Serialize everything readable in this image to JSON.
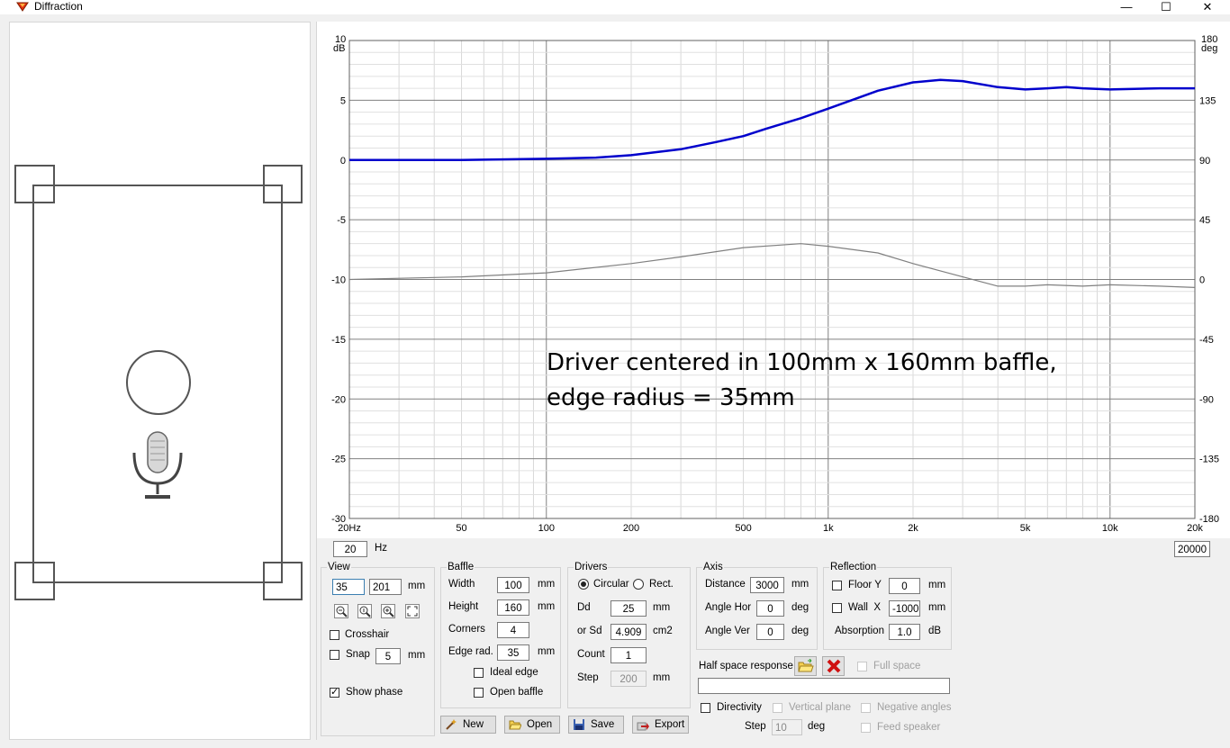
{
  "window": {
    "title": "Diffraction",
    "minimize": "—",
    "maximize": "☐",
    "close": "✕"
  },
  "graph": {
    "annotation_line1": "Driver centered in 100mm x 160mm baffle,",
    "annotation_line2": "edge radius = 35mm",
    "left_unit": "dB",
    "right_unit": "deg",
    "left_ticks": [
      "10",
      "5",
      "0",
      "-5",
      "-10",
      "-15",
      "-20",
      "-25",
      "-30"
    ],
    "right_ticks": [
      "180",
      "135",
      "90",
      "45",
      "0",
      "-45",
      "-90",
      "-135",
      "-180"
    ],
    "x_ticks": [
      "20Hz",
      "50",
      "100",
      "200",
      "500",
      "1k",
      "2k",
      "5k",
      "10k",
      "20k"
    ],
    "freq_min": "20",
    "freq_min_unit": "Hz",
    "freq_max": "20000"
  },
  "chart_data": {
    "type": "line",
    "x_scale": "log",
    "xlim": [
      20,
      20000
    ],
    "ylim": [
      -30,
      10
    ],
    "y2lim": [
      -180,
      180
    ],
    "grid": true,
    "series": [
      {
        "axis": "left",
        "color": "#0000cc",
        "x": [
          20,
          50,
          100,
          150,
          200,
          300,
          400,
          500,
          600,
          800,
          1000,
          1500,
          2000,
          2500,
          3000,
          4000,
          5000,
          6000,
          7000,
          8000,
          10000,
          15000,
          20000
        ],
        "values": [
          0,
          0,
          0.1,
          0.2,
          0.4,
          0.9,
          1.5,
          2.0,
          2.6,
          3.5,
          4.3,
          5.8,
          6.5,
          6.7,
          6.6,
          6.1,
          5.9,
          6.0,
          6.1,
          6.0,
          5.9,
          6.0,
          6.0
        ]
      },
      {
        "axis": "right",
        "color": "#808080",
        "x": [
          20,
          50,
          100,
          200,
          300,
          500,
          800,
          1000,
          1500,
          2000,
          3000,
          4000,
          5000,
          6000,
          8000,
          10000,
          15000,
          20000
        ],
        "values": [
          0,
          2,
          5,
          12,
          17,
          24,
          27,
          25,
          20,
          12,
          2,
          -5,
          -5,
          -4,
          -5,
          -4,
          -5,
          -6
        ]
      }
    ]
  },
  "view": {
    "title": "View",
    "x_value": "35",
    "y_value": "201",
    "unit": "mm",
    "crosshair": "Crosshair",
    "snap": "Snap",
    "snap_value": "5",
    "snap_unit": "mm",
    "show_phase": "Show phase"
  },
  "baffle": {
    "title": "Baffle",
    "width_label": "Width",
    "width": "100",
    "width_unit": "mm",
    "height_label": "Height",
    "height": "160",
    "height_unit": "mm",
    "corners_label": "Corners",
    "corners": "4",
    "edge_label": "Edge rad.",
    "edge": "35",
    "edge_unit": "mm",
    "ideal_edge": "Ideal edge",
    "open_baffle": "Open baffle"
  },
  "drivers": {
    "title": "Drivers",
    "circular": "Circular",
    "rect": "Rect.",
    "dd_label": "Dd",
    "dd": "25",
    "dd_unit": "mm",
    "sd_label": "or Sd",
    "sd": "4.909",
    "sd_unit": "cm2",
    "count_label": "Count",
    "count": "1",
    "step_label": "Step",
    "step": "200",
    "step_unit": "mm"
  },
  "axis": {
    "title": "Axis",
    "distance_label": "Distance",
    "distance": "3000",
    "distance_unit": "mm",
    "hor_label": "Angle Hor",
    "hor": "0",
    "hor_unit": "deg",
    "ver_label": "Angle Ver",
    "ver": "0",
    "ver_unit": "deg"
  },
  "reflection": {
    "title": "Reflection",
    "floor_label": "Floor Y",
    "floor": "0",
    "floor_unit": "mm",
    "wall_label": "Wall  X",
    "wall": "-1000",
    "wall_unit": "mm",
    "absorption_label": "Absorption",
    "absorption": "1.0",
    "absorption_unit": "dB"
  },
  "halfspace": {
    "label": "Half space response",
    "full_space": "Full space",
    "path": ""
  },
  "directivity": {
    "label": "Directivity",
    "vertical": "Vertical plane",
    "negative": "Negative angles",
    "step_label": "Step",
    "step": "10",
    "step_unit": "deg",
    "feed": "Feed speaker"
  },
  "buttons": {
    "new": "New",
    "open": "Open",
    "save": "Save",
    "export": "Export"
  }
}
